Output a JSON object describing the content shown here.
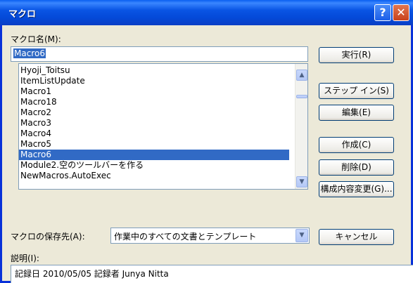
{
  "window": {
    "title": "マクロ",
    "help_label": "?",
    "close_label": "✕"
  },
  "macro_name": {
    "label": "マクロ名(M):",
    "value": "Macro6"
  },
  "macro_list": {
    "items": [
      "Hyoji_Toitsu",
      "ItemListUpdate",
      "Macro1",
      "Macro18",
      "Macro2",
      "Macro3",
      "Macro4",
      "Macro5",
      "Macro6",
      "Module2.空のツールバーを作る",
      "NewMacros.AutoExec"
    ],
    "selected": "Macro6"
  },
  "buttons": {
    "run": "実行(R)",
    "step_in": "ステップ イン(S)",
    "edit": "編集(E)",
    "create": "作成(C)",
    "delete": "削除(D)",
    "organizer": "構成内容変更(G)...",
    "cancel": "キャンセル"
  },
  "storage": {
    "label": "マクロの保存先(A):",
    "value": "作業中のすべての文書とテンプレート"
  },
  "description": {
    "label": "説明(I):",
    "value": "記録日 2010/05/05 記録者 Junya Nitta"
  },
  "colors": {
    "title_bar": "#0A55E4",
    "dialog_bg": "#ECE9D8",
    "selection": "#316AC5",
    "close_button": "#C9421C"
  },
  "icons": [
    "help-icon",
    "close-icon",
    "chevron-up-icon",
    "chevron-down-icon"
  ]
}
